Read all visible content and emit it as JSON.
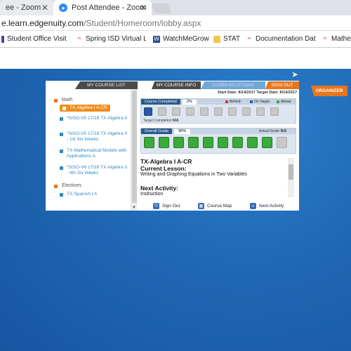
{
  "browser": {
    "tabs": [
      {
        "label": "ee - Zoom",
        "close": "✕"
      },
      {
        "label": "Post Attendee - Zoom",
        "close": "✕"
      }
    ],
    "address": {
      "host": "e.learn.edgenuity.com",
      "path": "/Student/Homeroom/lobby.aspx"
    },
    "bookmarks": [
      {
        "label": "Student Office Visit R",
        "icon": "purple-bar-icon"
      },
      {
        "label": "Spring ISD Virtual Lea",
        "icon": "logo-icon"
      },
      {
        "label": "WatchMeGrow",
        "icon": "w-icon"
      },
      {
        "label": "STAT",
        "icon": "folder-icon"
      },
      {
        "label": "Documentation Data",
        "icon": "logo-icon"
      },
      {
        "label": "Mathe",
        "icon": "logo-icon"
      }
    ]
  },
  "left_panel": {
    "title": "MY COURSE LIST",
    "groups": [
      {
        "label": "Math"
      },
      {
        "label": "Electives"
      }
    ],
    "courses": [
      {
        "label": "TX-Algebra I A-CR",
        "selected": true
      },
      {
        "label": "*SISO-V5 17/18 TX-Algebra II"
      },
      {
        "label": "*SISO-V5 17/18 TX-Algebra II - 1st Six Weeks"
      },
      {
        "label": "TX-Mathematical Models with Applications A"
      },
      {
        "label": "*SISO-V6 17/18 TX-Algebra II - 4th Six Weeks"
      },
      {
        "label": "TX-Spanish I A"
      }
    ]
  },
  "right_panel": {
    "tabs": [
      "MY COURSE INFO",
      "COMMUNICATIONS",
      "SIGN OUT"
    ],
    "dates": "Start Date: 8/14/2017  Target Date: 8/14/2017",
    "course_completed": {
      "label": "Course Completed",
      "value": "2%",
      "target_label": "Target Completion",
      "target_value": "N/A"
    },
    "legend": [
      {
        "label": "Behind",
        "color": "#d9342b"
      },
      {
        "label": "On Target",
        "color": "#2a5aaa"
      },
      {
        "label": "Ahead",
        "color": "#3aaa3a"
      }
    ],
    "overall_grade": {
      "label": "Overall Grade",
      "value": "90%",
      "actual_label": "Actual Grade",
      "actual_value": "N/A"
    },
    "course_title": "TX-Algebra I A-CR",
    "current_lesson_label": "Current Lesson:",
    "current_lesson": "Writing and Graphing Equations in Two Variables",
    "next_activity_label": "Next Activity:",
    "next_activity": "Instruction",
    "footer": [
      "Sign Out",
      "Course Map",
      "Next Activity"
    ]
  },
  "organizer": "ORGANIZER",
  "colors": {
    "accent": "#e8761e",
    "link": "#2e8bc0",
    "background": "#1a5aa0"
  }
}
